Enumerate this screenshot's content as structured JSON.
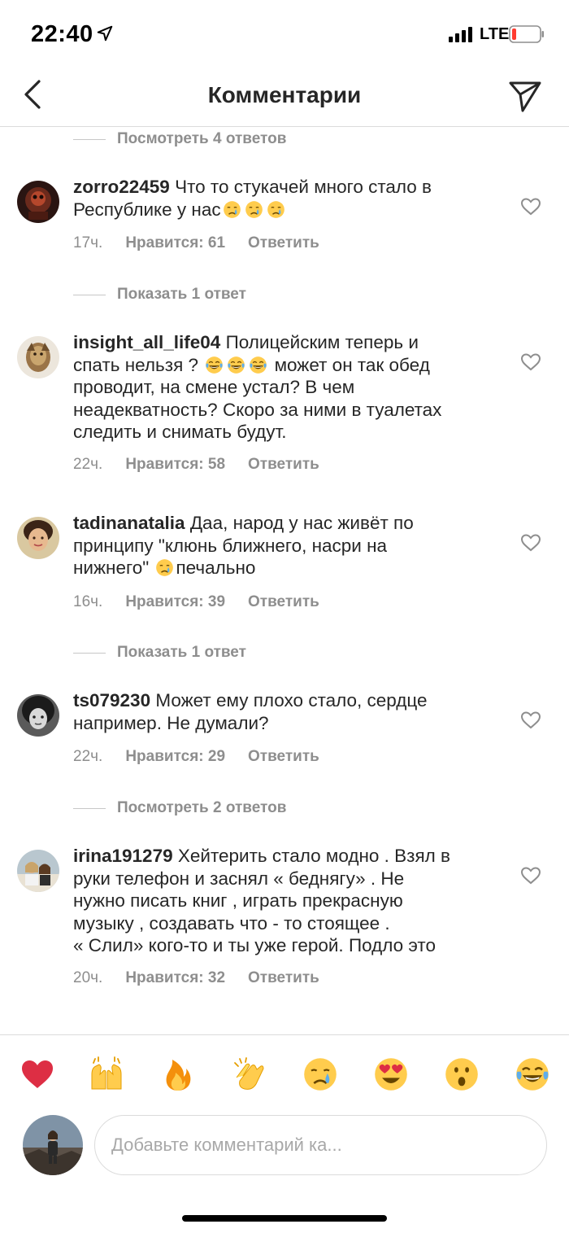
{
  "status_bar": {
    "time": "22:40",
    "network": "LTE",
    "icons": [
      "location-arrow-icon",
      "signal-bars-icon",
      "battery-low-icon"
    ]
  },
  "header": {
    "title": "Комментарии",
    "back_icon": "chevron-left-icon",
    "send_icon": "paper-plane-icon"
  },
  "reply_toggles": [
    "Посмотреть 4 ответов",
    "Показать 1 ответ",
    "Показать 1 ответ",
    "Посмотреть 2 ответов"
  ],
  "comments": [
    {
      "username": "zorro22459",
      "text": [
        "Что то стукачей много стало в",
        "Республике у нас"
      ],
      "time": "17ч.",
      "likes": "Нравится: 61",
      "reply": "Ответить"
    },
    {
      "username": "insight_all_life04",
      "text": [
        "Полицейским теперь и",
        "спать нельзя ?",
        "может он так обед",
        "проводит, на смене устал? В чем",
        "неадекватность? Скоро за ними в туалетах",
        "следить и снимать будут."
      ],
      "time": "22ч.",
      "likes": "Нравится: 58",
      "reply": "Ответить"
    },
    {
      "username": "tadinanatalia",
      "text": [
        "Даа, народ у нас живёт по",
        "принципу \"клюнь ближнего, насри на",
        "нижнего\"",
        "печально"
      ],
      "time": "16ч.",
      "likes": "Нравится: 39",
      "reply": "Ответить"
    },
    {
      "username": "ts079230",
      "text": [
        "Может ему плохо стало, сердце",
        "например. Не думали?"
      ],
      "time": "22ч.",
      "likes": "Нравится: 29",
      "reply": "Ответить"
    },
    {
      "username": "irina191279",
      "text": [
        "Хейтерить стало модно . Взял в",
        "руки телефон и заснял « беднягу» . Не",
        "нужно писать книг , играть прекрасную",
        "музыку , создавать что - то стоящее .",
        "« Слил» кого-то и ты уже герой. Подло это"
      ],
      "time": "20ч.",
      "likes": "Нравится: 32",
      "reply": "Ответить"
    }
  ],
  "quick_emojis": [
    "red-heart-emoji",
    "raised-hands-emoji",
    "fire-emoji",
    "clapping-hands-emoji",
    "crying-face-emoji",
    "heart-eyes-emoji",
    "surprised-face-emoji",
    "tears-of-joy-emoji"
  ],
  "composer": {
    "placeholder": "Добавьте комментарий ка..."
  },
  "colors": {
    "text": "#262626",
    "secondary": "#8e8e8e",
    "divider": "#dbdbdb",
    "battery_low": "#ff3b30",
    "emoji_yellow": "#ffcc4d"
  }
}
